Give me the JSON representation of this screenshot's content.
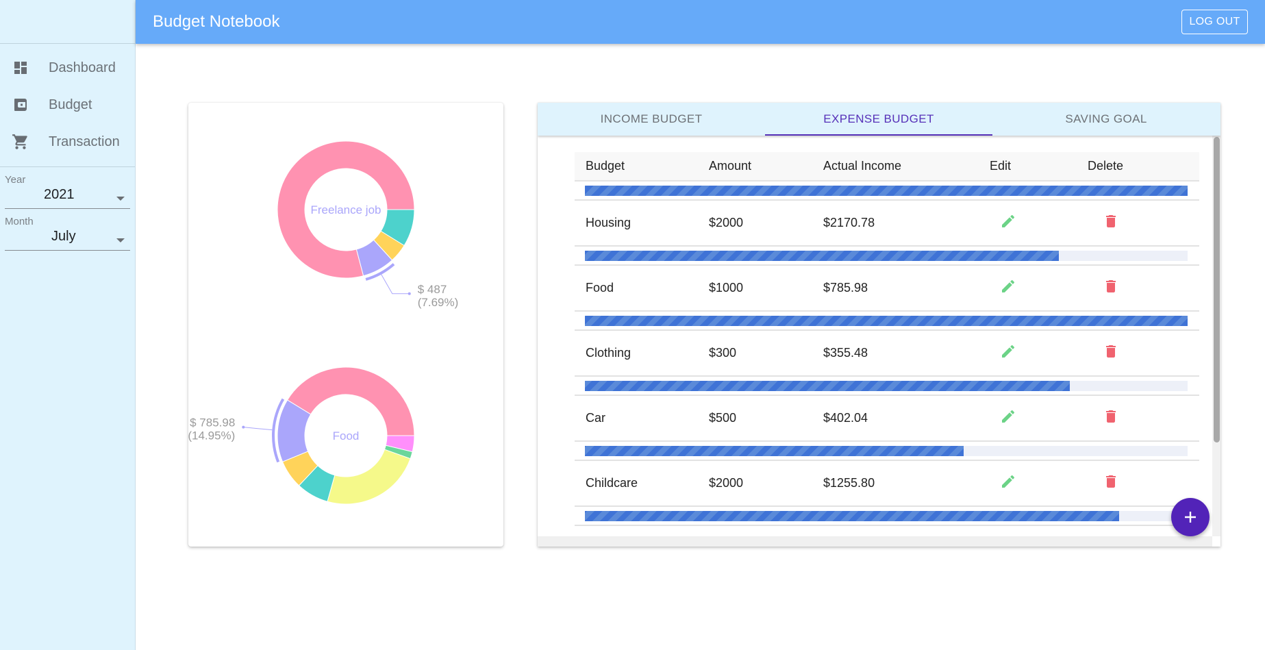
{
  "app": {
    "title": "Budget Notebook",
    "logout_label": "LOG OUT"
  },
  "sidebar": {
    "items": [
      {
        "label": "Dashboard",
        "icon": "dashboard-icon"
      },
      {
        "label": "Budget",
        "icon": "wallet-icon"
      },
      {
        "label": "Transaction",
        "icon": "cart-icon"
      }
    ],
    "year": {
      "label": "Year",
      "value": "2021"
    },
    "month": {
      "label": "Month",
      "value": "July"
    }
  },
  "tabs": [
    {
      "label": "INCOME BUDGET",
      "active": false
    },
    {
      "label": "EXPENSE BUDGET",
      "active": true
    },
    {
      "label": "SAVING GOAL",
      "active": false
    }
  ],
  "table": {
    "headers": [
      "Budget",
      "Amount",
      "Actual Income",
      "Edit",
      "Delete"
    ],
    "rows": [
      {
        "budget": "Housing",
        "amount": "$2000",
        "actual": "$2170.78",
        "progress": 100
      },
      {
        "budget": "Food",
        "amount": "$1000",
        "actual": "$785.98",
        "progress": 78.6
      },
      {
        "budget": "Clothing",
        "amount": "$300",
        "actual": "$355.48",
        "progress": 100
      },
      {
        "budget": "Car",
        "amount": "$500",
        "actual": "$402.04",
        "progress": 80.4
      },
      {
        "budget": "Childcare",
        "amount": "$2000",
        "actual": "$1255.80",
        "progress": 62.8
      }
    ],
    "next_row_progress": 88.6
  },
  "fab": {
    "icon": "plus-icon"
  },
  "colors": {
    "appbar": "#66aaf9",
    "sidebar": "#dff3fd",
    "accent": "#5630b8",
    "fab": "#5223b8",
    "edit": "#6cd387",
    "delete": "#f0636f",
    "progress": "#3f73d6"
  },
  "chart_data": [
    {
      "type": "pie",
      "variant": "donut",
      "title": "Freelance job",
      "start_angle_deg": 0,
      "direction": "clockwise",
      "slices": [
        {
          "label": "",
          "value": 557,
          "color": "#4dd2cc"
        },
        {
          "label": "",
          "value": 279,
          "color": "#ffd35a"
        },
        {
          "label": "Freelance job",
          "value": 487,
          "percent": 7.69,
          "color": "#aaa6fb",
          "highlighted": true
        },
        {
          "label": "",
          "value": 5010,
          "color": "#ff92b1"
        }
      ],
      "annotation": {
        "line1": "$ 487",
        "line2": "(7.69%)"
      }
    },
    {
      "type": "pie",
      "variant": "donut",
      "title": "Food",
      "start_angle_deg": 0,
      "direction": "clockwise",
      "slices": [
        {
          "label": "",
          "value": 200.0,
          "color": "#ff8ffb"
        },
        {
          "label": "",
          "value": 87.5,
          "color": "#6ad69b"
        },
        {
          "label": "Childcare",
          "value": 1255.8,
          "color": "#f5f98a"
        },
        {
          "label": "Car",
          "value": 402.04,
          "color": "#4dd2cc"
        },
        {
          "label": "Clothing",
          "value": 355.48,
          "color": "#ffd35a"
        },
        {
          "label": "Food",
          "value": 785.98,
          "percent": 14.95,
          "color": "#aaa6fb",
          "highlighted": true
        },
        {
          "label": "Housing",
          "value": 2170.78,
          "color": "#ff92b1"
        }
      ],
      "annotation": {
        "line1": "$ 785.98",
        "line2": "(14.95%)"
      }
    }
  ]
}
